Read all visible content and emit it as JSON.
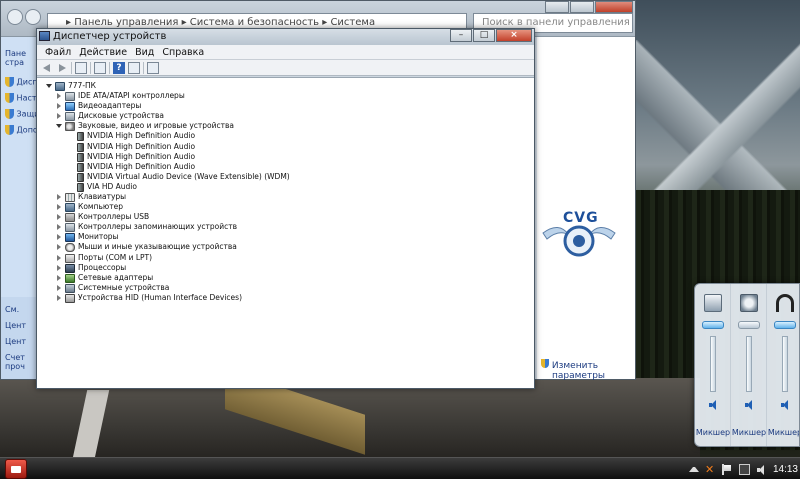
{
  "back_window": {
    "breadcrumb": "▸ Панель управления ▸ Система и безопасность ▸ Система",
    "search_placeholder": "Поиск в панели управления",
    "sidebar": {
      "heading": [
        "Пане",
        "стра"
      ],
      "items": [
        "Дисп",
        "Наст",
        "Защи",
        "Допо"
      ],
      "bottom": [
        "См.",
        "Цент",
        "Цент",
        "Счет",
        "проч"
      ]
    },
    "change_params": [
      "Изменить",
      "параметры"
    ],
    "logo_text": "CVG"
  },
  "device_manager": {
    "title": "Диспетчер устройств",
    "menu": [
      "Файл",
      "Действие",
      "Вид",
      "Справка"
    ],
    "toolbar": [
      "back-arrow-icon",
      "forward-arrow-icon",
      "properties-icon",
      "help-icon",
      "scan-icon"
    ],
    "root": "777-ПК",
    "tree": [
      {
        "label": "IDE ATA/ATAPI контроллеры",
        "icon": "drive",
        "expanded": false
      },
      {
        "label": "Видеоадаптеры",
        "icon": "display",
        "expanded": false
      },
      {
        "label": "Дисковые устройства",
        "icon": "drive",
        "expanded": false
      },
      {
        "label": "Звуковые, видео и игровые устройства",
        "icon": "sound",
        "expanded": true,
        "children": [
          "NVIDIA High Definition Audio",
          "NVIDIA High Definition Audio",
          "NVIDIA High Definition Audio",
          "NVIDIA High Definition Audio",
          "NVIDIA Virtual Audio Device (Wave Extensible) (WDM)",
          "VIA HD Audio"
        ]
      },
      {
        "label": "Клавиатуры",
        "icon": "kbd",
        "expanded": false
      },
      {
        "label": "Компьютер",
        "icon": "pc",
        "expanded": false
      },
      {
        "label": "Контроллеры USB",
        "icon": "usb",
        "expanded": false
      },
      {
        "label": "Контроллеры запоминающих устройств",
        "icon": "drive",
        "expanded": false
      },
      {
        "label": "Мониторы",
        "icon": "monitor",
        "expanded": false
      },
      {
        "label": "Мыши и иные указывающие устройства",
        "icon": "mouse",
        "expanded": false
      },
      {
        "label": "Порты (COM и LPT)",
        "icon": "port",
        "expanded": false
      },
      {
        "label": "Процессоры",
        "icon": "cpu",
        "expanded": false
      },
      {
        "label": "Сетевые адаптеры",
        "icon": "net",
        "expanded": false
      },
      {
        "label": "Системные устройства",
        "icon": "sys",
        "expanded": false
      },
      {
        "label": "Устройства HID (Human Interface Devices)",
        "icon": "hid",
        "expanded": false
      }
    ]
  },
  "mixer": {
    "channels": [
      {
        "label": "Микшер",
        "device_icon": "speakers-icon"
      },
      {
        "label": "Микшер",
        "device_icon": "system-sounds-icon"
      },
      {
        "label": "Микшер",
        "device_icon": "headphones-icon"
      }
    ]
  },
  "taskbar": {
    "clock": "14:13"
  }
}
